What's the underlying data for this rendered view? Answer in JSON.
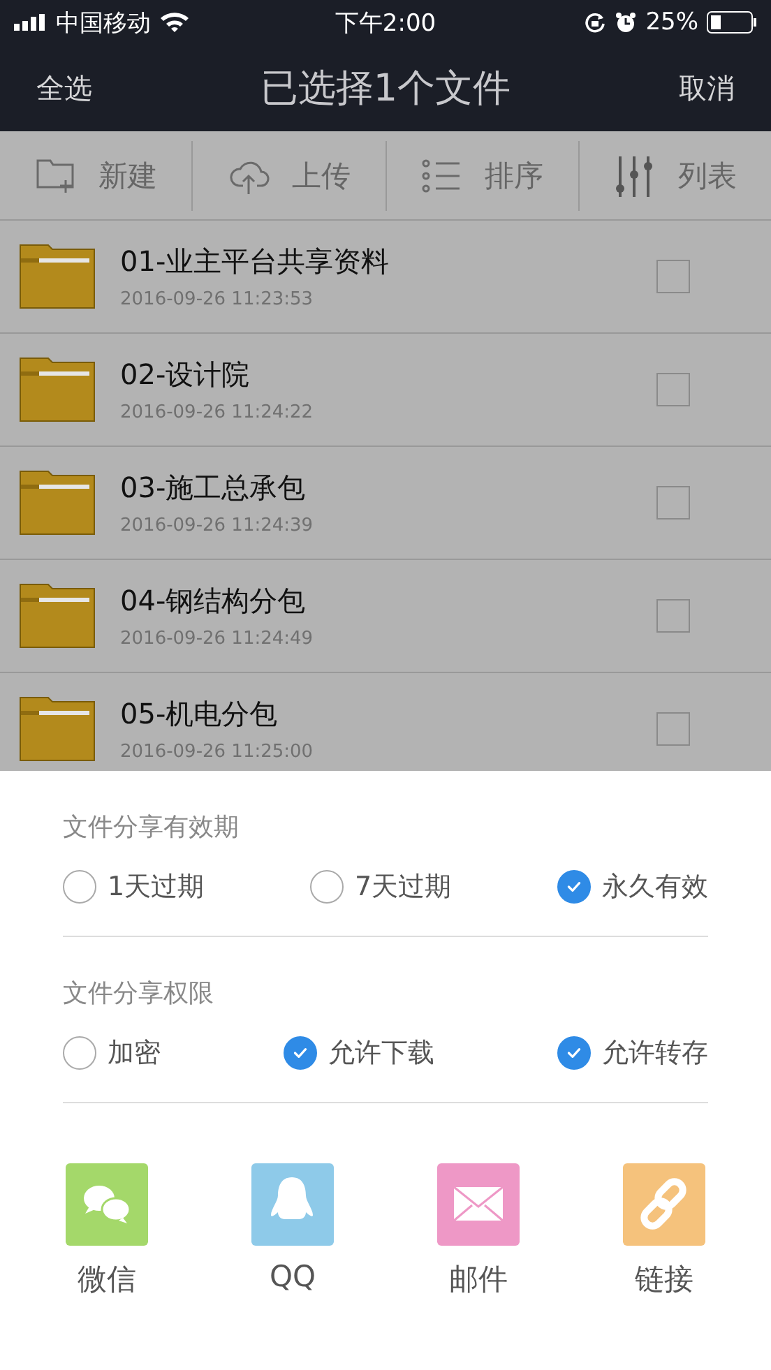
{
  "status_bar": {
    "carrier": "中国移动",
    "time": "下午2:00",
    "battery": "25%"
  },
  "nav": {
    "left": "全选",
    "title": "已选择1个文件",
    "right": "取消"
  },
  "toolbar": [
    {
      "kind": "new",
      "label": "新建"
    },
    {
      "kind": "upload",
      "label": "上传"
    },
    {
      "kind": "sort",
      "label": "排序"
    },
    {
      "kind": "view",
      "label": "列表"
    }
  ],
  "files": [
    {
      "name": "01-业主平台共享资料",
      "date": "2016-09-26 11:23:53",
      "checked": false
    },
    {
      "name": "02-设计院",
      "date": "2016-09-26 11:24:22",
      "checked": false
    },
    {
      "name": "03-施工总承包",
      "date": "2016-09-26 11:24:39",
      "checked": false
    },
    {
      "name": "04-钢结构分包",
      "date": "2016-09-26 11:24:49",
      "checked": false
    },
    {
      "name": "05-机电分包",
      "date": "2016-09-26 11:25:00",
      "checked": false
    }
  ],
  "sheet": {
    "validity": {
      "title": "文件分享有效期",
      "options": [
        {
          "label": "1天过期",
          "selected": false
        },
        {
          "label": "7天过期",
          "selected": false
        },
        {
          "label": "永久有效",
          "selected": true
        }
      ]
    },
    "permissions": {
      "title": "文件分享权限",
      "options": [
        {
          "label": "加密",
          "checked": false
        },
        {
          "label": "允许下载",
          "checked": true
        },
        {
          "label": "允许转存",
          "checked": true
        }
      ]
    },
    "targets": [
      {
        "kind": "wechat",
        "label": "微信",
        "color": "#a4d86a"
      },
      {
        "kind": "qq",
        "label": "QQ",
        "color": "#8ecae9"
      },
      {
        "kind": "mail",
        "label": "邮件",
        "color": "#ee98c6"
      },
      {
        "kind": "link",
        "label": "链接",
        "color": "#f5c27c"
      }
    ]
  }
}
